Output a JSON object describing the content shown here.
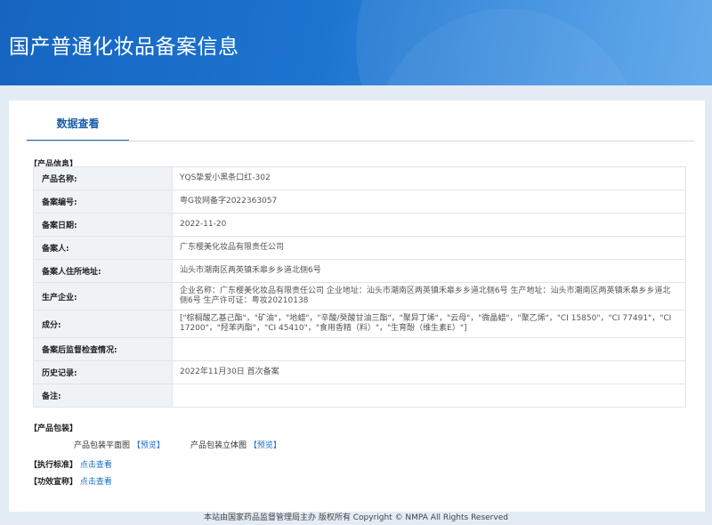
{
  "header": {
    "title": "国产普通化妆品备案信息"
  },
  "tab": {
    "label": "数据查看"
  },
  "sections": {
    "product_info": "【产品信息】",
    "packaging": "【产品包装】",
    "standard": "【执行标准】",
    "efficacy": "【功效宣称】"
  },
  "product_rows": [
    {
      "label": "产品名称:",
      "value": "YQS挚爱小黑条口红-302"
    },
    {
      "label": "备案编号:",
      "value": "粤G妆网备字2022363057"
    },
    {
      "label": "备案日期:",
      "value": "2022-11-20"
    },
    {
      "label": "备案人:",
      "value": "广东樱美化妆品有限责任公司"
    },
    {
      "label": "备案人住所地址:",
      "value": "汕头市潮南区两英镇禾皋乡乡道北侧6号"
    },
    {
      "label": "生产企业:",
      "value": "企业名称：广东樱美化妆品有限责任公司 企业地址：汕头市潮南区两英镇禾皋乡乡道北侧6号 生产地址：汕头市潮南区两英镇禾皋乡乡道北侧6号 生产许可证：粤妆20210138"
    },
    {
      "label": "成分:",
      "value": "[\"棕榈酸乙基己酯\"，\"矿油\"，\"地蜡\"，\"辛酸/癸酸甘油三酯\"，\"聚异丁烯\"，\"云母\"，\"微晶蜡\"，\"聚乙烯\"，\"CI 15850\"，\"CI 77491\"，\"CI 17200\"，\"羟苯丙酯\"，\"CI 45410\"，\"食用香精（料）\"，\"生育酚（维生素E）\"]"
    },
    {
      "label": "备案后监督检查情况:",
      "value": ""
    },
    {
      "label": "历史记录:",
      "value": "2022年11月30日 首次备案"
    },
    {
      "label": "备注:",
      "value": ""
    }
  ],
  "packaging": {
    "flat_label": "产品包装平面图",
    "flat_preview": "【预览】",
    "solid_label": "产品包装立体图",
    "solid_preview": "【预览】"
  },
  "standard": {
    "link": "点击查看"
  },
  "efficacy": {
    "link": "点击查看"
  },
  "footer": {
    "text": "本站由国家药品监督管理局主办 版权所有 Copyright © NMPA All Rights Reserved"
  }
}
